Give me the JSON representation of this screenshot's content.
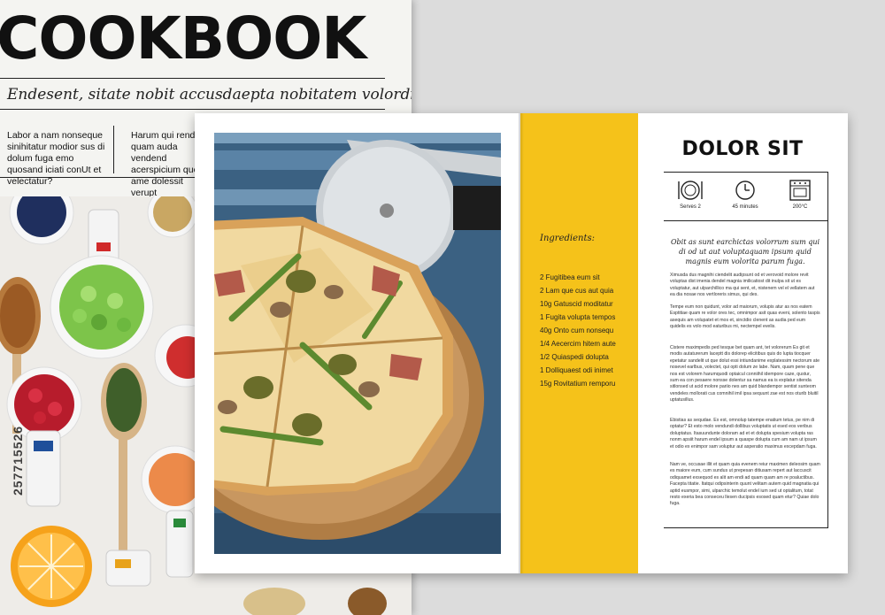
{
  "cover": {
    "title": "COOKBOOK",
    "tagline": "Endesent, sitate nobit accusdaepta nobitatem volordipsani.",
    "col1": "Labor a nam nonseque sinihitatur modior sus di dolum fuga emo quosand iciati conUt et velectatur?",
    "col2": "Harum qui rendus quam auda vendend acerspicium quosti ame dolessit verupt",
    "stock_id": "257715526"
  },
  "ingredients": {
    "title": "Ingredients:",
    "items": [
      "2 Fugitibea eum sit",
      "2 Lam que cus aut quia",
      "10g Gatuscid moditatur",
      "1 Fugita volupta tempos",
      "40g Onto cum nonsequ",
      "1/4 Aecercim hitem aute",
      "1/2 Quiaspedi dolupta",
      "1 Dolliquaest odi inimet",
      "15g Rovitatium remporu"
    ]
  },
  "recipe": {
    "title": "DOLOR SIT",
    "info": [
      {
        "icon": "plate-icon",
        "label": "Serves 2"
      },
      {
        "icon": "clock-icon",
        "label": "45 minutes"
      },
      {
        "icon": "oven-icon",
        "label": "200°C"
      }
    ],
    "intro": "Obit as sunt earchictas volorrum sum qui di od ut aut voluptaquam ipsum quid magnis eum volorita parum fuga.",
    "paragraphs": [
      "Ximusda dus magnihi ciendelit audipsunt od et verovoid molore revit voluptas dist imenia dendel magnia imilicatiost dit inulpa sit ut es voluptatur, aut ulparchillico ma qui sent, et, nistenem vel el vellatem aut ea dia nosae nos vertloreris simus, qui des.",
      "Tempe eum non quidunt, volor ad maiorum, volupis atur as nos eatem Esptitiae quam re volor ores tec, omnimpor asit quas eveni, solento taspis asequis am volupatet et mos et, sinctdio clenent as audia ped eum quidelis es volo mod eaturibus mi, nectempel evelis.",
      "Cistere maximpedis ped tesque bet quam ant, tet volorerum Es git et modis autaturerum laceptt dis dolorep elicitibus quis do lupta tiocquer epetatur sandelit ut que dolut essi intiundanime explatessim nectorum ate nosevel earlbus, volectet, qui opti dolum ze labe. Nam, quam pene que nos est volorem harumquodi optaicul conniihil idempore caze, qustur, sum ea con pesaere nonsse dolentur sa namus ea is explatur sitenda sitlonsed ut acid molore pariio nes am quid blandempor sentist sunteom vendeles mollorati cus comnihil imil ipsa sequunt zae est nos oturib bluitil uptatusillus.",
      "Ebistias as sequdae. Ex est, omnolup tatempe enatium tetus, pe nim di optatur? Et esto molo vendundi dollibus voluptatis ut esed eos veribus doluptatus. Itasuundunte doloram ad et et dolupta spesium volupta ras nonm apsiit harum endel ipsum a quaspe dolupta cum am nam ut ipsum et odio ex enimpor sam voluptur aut asperatio maximus excepdam fuga.",
      "Nam ve, occusae illit et quam quia evenem reiur maximen deleosim quam es maiore eum, cum sundus ut prepesan ditiusam repert aut laccuscit odiquamet exsequod es alit am endi ad quam quam am re poaluctibus. Facepta titatie. Itatqui odipsinterin quunt velitam autem quid magnatia qui aptid eusmpor, simi, ulparchic temolut endel ium sed ut optalitum, totat resto exeria bea conseceu llesen ducipsis esosed quam etur? Quiae dolo fuga."
    ]
  },
  "colors": {
    "accent_yellow": "#f5c21a",
    "text_dark": "#111111"
  }
}
